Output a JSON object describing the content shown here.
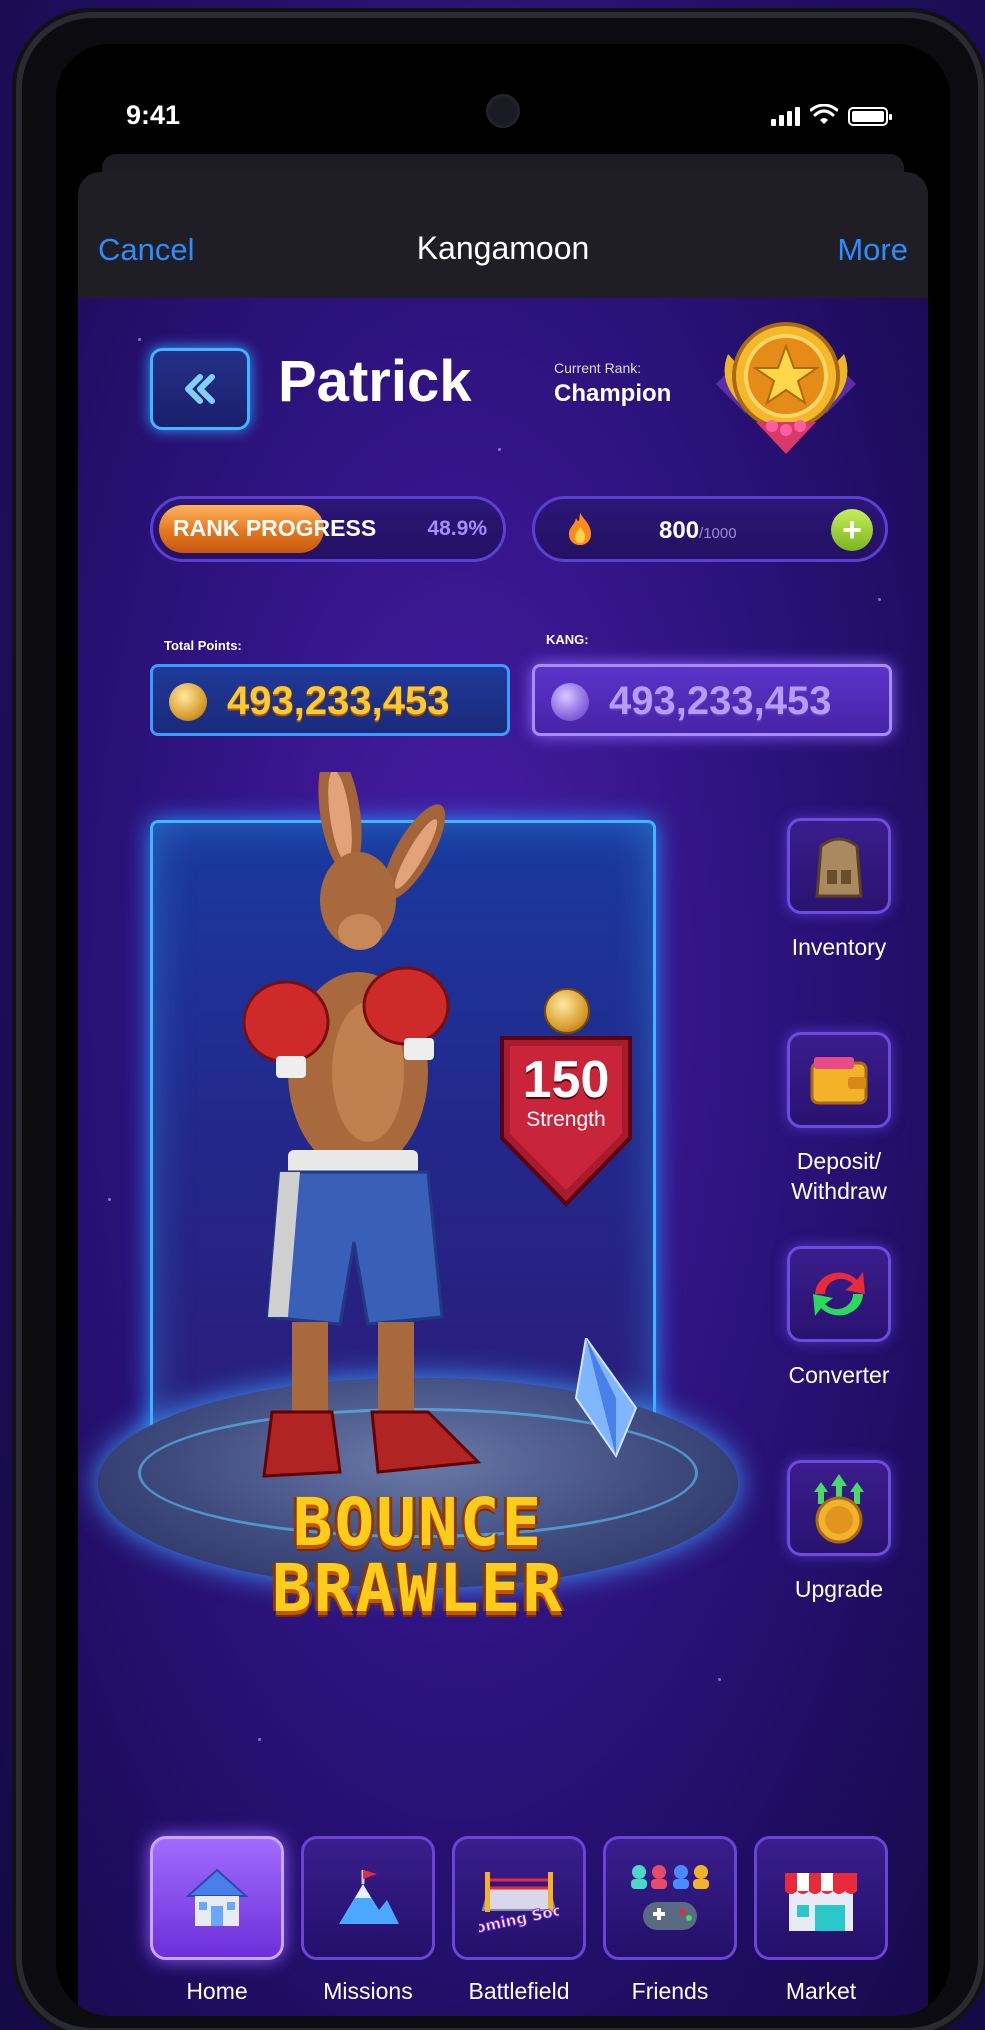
{
  "status": {
    "time": "9:41"
  },
  "navbar": {
    "cancel": "Cancel",
    "title": "Kangamoon",
    "more": "More"
  },
  "profile": {
    "name": "Patrick",
    "rank_label": "Current Rank:",
    "rank": "Champion"
  },
  "rank_progress": {
    "label": "RANK PROGRESS",
    "percent_text": "48.9%",
    "fraction": 0.489
  },
  "energy": {
    "value": "800",
    "max": "/1000"
  },
  "balances": {
    "points_label": "Total Points:",
    "points": "493,233,453",
    "kang_label": "KANG:",
    "kang": "493,233,453"
  },
  "character": {
    "strength": "150",
    "strength_label": "Strength",
    "title_line1": "BOUNCE",
    "title_line2": "BRAWLER"
  },
  "side_menu": [
    {
      "label": "Inventory",
      "icon": "backpack-icon"
    },
    {
      "label": "Deposit/ Withdraw",
      "icon": "wallet-icon"
    },
    {
      "label": "Converter",
      "icon": "convert-arrows-icon"
    },
    {
      "label": "Upgrade",
      "icon": "upgrade-coin-icon"
    }
  ],
  "tabs": [
    {
      "label": "Home",
      "icon": "house-icon",
      "active": true
    },
    {
      "label": "Missions",
      "icon": "mountain-flag-icon"
    },
    {
      "label": "Battlefield",
      "icon": "boxing-ring-icon",
      "badge": "Coming Soon"
    },
    {
      "label": "Friends",
      "icon": "friends-gamepad-icon"
    },
    {
      "label": "Market",
      "icon": "market-stall-icon"
    }
  ],
  "colors": {
    "accent_blue": "#2d8cff",
    "progress_orange": "#e0731c",
    "points_gold": "#ffc930",
    "kang_purple": "#b69cff"
  }
}
